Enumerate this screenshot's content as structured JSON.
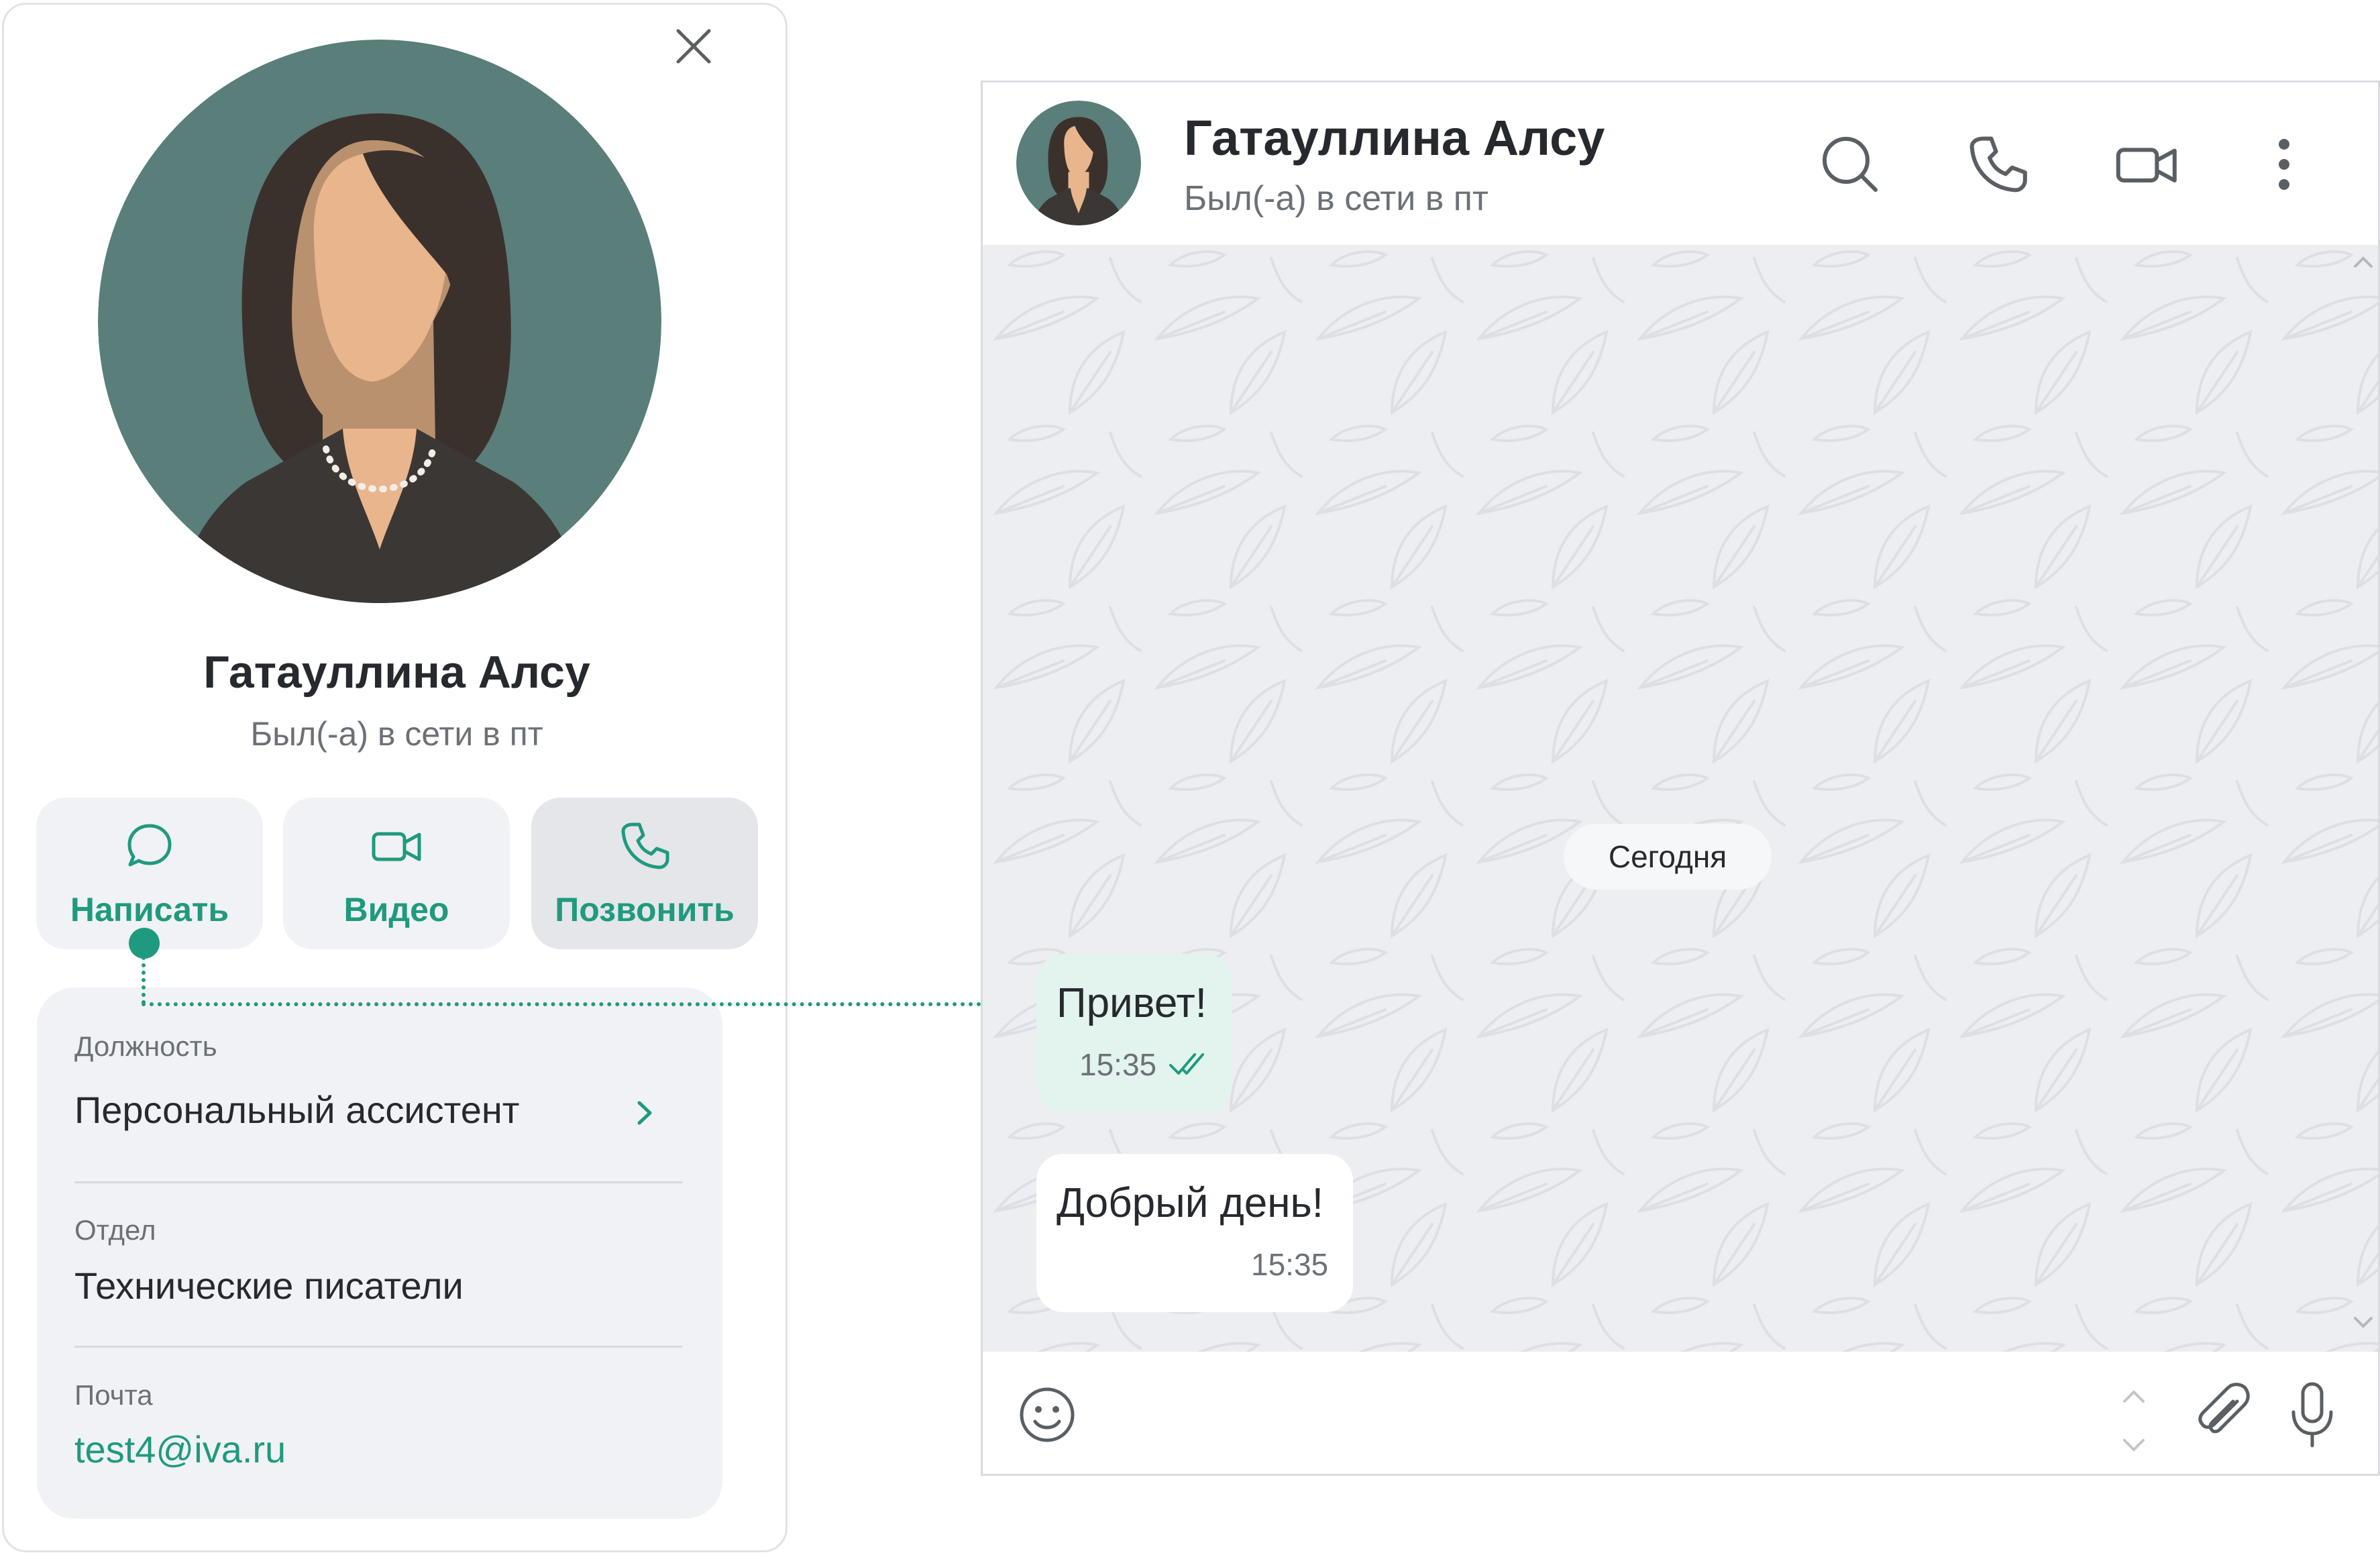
{
  "profile": {
    "name": "Гатауллина Алсу",
    "status": "Был(-а) в сети в пт",
    "actions": [
      {
        "label": "Написать",
        "icon": "chat-bubble-icon"
      },
      {
        "label": "Видео",
        "icon": "video-camera-icon"
      },
      {
        "label": "Позвонить",
        "icon": "phone-icon"
      }
    ],
    "info": {
      "position_label": "Должность",
      "position_value": "Персональный ассистент",
      "department_label": "Отдел",
      "department_value": "Технические писатели",
      "email_label": "Почта",
      "email_value": "test4@iva.ru"
    }
  },
  "chat": {
    "name": "Гатауллина Алсу",
    "status": "Был(-а) в сети в пт",
    "header_icons": [
      "search-icon",
      "phone-icon",
      "video-camera-icon",
      "more-vertical-icon"
    ],
    "date_chip": "Сегодня",
    "messages": [
      {
        "text": "Привет!",
        "time": "15:35",
        "direction": "outgoing",
        "read": true
      },
      {
        "text": "Добрый день!",
        "time": "15:35",
        "direction": "incoming"
      }
    ],
    "input_icons": [
      "emoji-icon",
      "attach-icon",
      "microphone-icon"
    ]
  },
  "colors": {
    "accent": "#1f9a7e",
    "avatar_bg": "#5a7e79",
    "outgoing_bubble": "#e3f3ed",
    "chat_background": "#eceef1"
  }
}
